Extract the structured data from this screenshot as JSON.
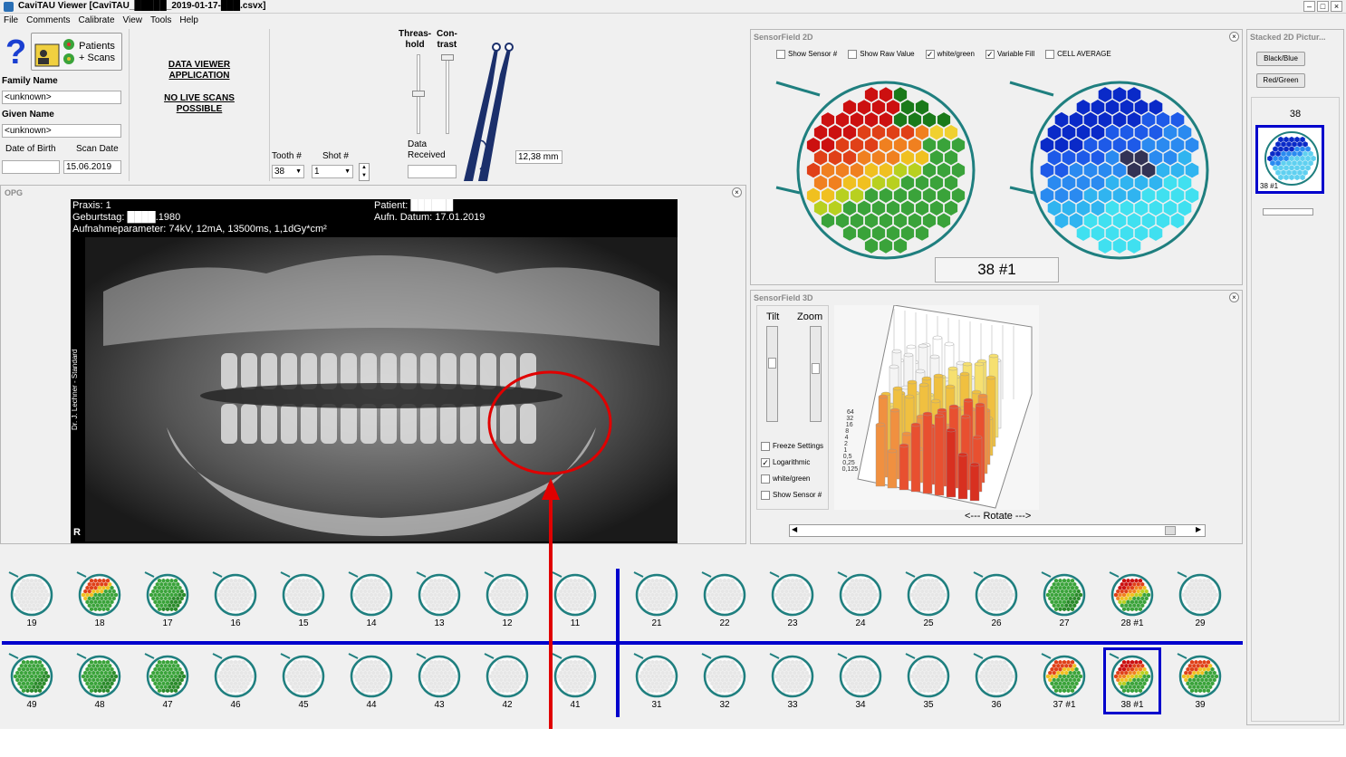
{
  "window": {
    "title": "CaviTAU Viewer [CaviTAU_█████_2019-01-17-███.csvx]"
  },
  "menu": [
    "File",
    "Comments",
    "Calibrate",
    "View",
    "Tools",
    "Help"
  ],
  "patient": {
    "button_label": "Patients\n+ Scans",
    "family_label": "Family Name",
    "family_value": "<unknown>",
    "given_label": "Given Name",
    "given_value": "<unknown>",
    "dob_label": "Date of Birth",
    "dob_value": "",
    "scan_label": "Scan Date",
    "scan_value": "15.06.2019"
  },
  "notice": {
    "line1": "DATA VIEWER",
    "line2": "APPLICATION",
    "line3": "NO LIVE SCANS",
    "line4": "POSSIBLE"
  },
  "selectors": {
    "tooth_label": "Tooth #",
    "tooth_value": "38",
    "shot_label": "Shot #",
    "shot_value": "1"
  },
  "controls": {
    "threshold_label_1": "Threas-",
    "threshold_label_2": "hold",
    "contrast_label_1": "Con-",
    "contrast_label_2": "trast",
    "data_received_1": "Data",
    "data_received_2": "Received",
    "measure": "12,38 mm"
  },
  "sensorfield2d": {
    "title": "SensorField 2D",
    "options": [
      {
        "label": "Show Sensor #",
        "checked": false
      },
      {
        "label": "Show Raw Value",
        "checked": false
      },
      {
        "label": "white/green",
        "checked": true
      },
      {
        "label": "Variable Fill",
        "checked": true
      },
      {
        "label": "CELL AVERAGE",
        "checked": false
      }
    ],
    "readout": "38 #1"
  },
  "stacked": {
    "title": "Stacked 2D Pictur...",
    "btn_blue": "Black/Blue",
    "btn_red": "Red/Green",
    "tooth": "38",
    "thumb_label": "38 #1"
  },
  "opg": {
    "title": "OPG",
    "praxis": "Praxis: 1",
    "patient": "Patient: ██████",
    "birth": "Geburtstag: ████.1980",
    "date": "Aufn. Datum: 17.01.2019",
    "params": "Aufnahmeparameter: 74kV, 12mA, 13500ms, 1,1dGy*cm²",
    "side": "Dr. J. Lechner - Standard",
    "marker": "R"
  },
  "sensorfield3d": {
    "title": "SensorField 3D",
    "tilt": "Tilt",
    "zoom": "Zoom",
    "options": [
      {
        "label": "Freeze Settings",
        "checked": false
      },
      {
        "label": "Logarithmic",
        "checked": true
      },
      {
        "label": "white/green",
        "checked": false
      },
      {
        "label": "Show Sensor #",
        "checked": false
      }
    ],
    "axis_ticks": [
      "64",
      "32",
      "16",
      "8",
      "4",
      "2",
      "1",
      "0,5",
      "0,25",
      "0,125"
    ],
    "rotate": "<--- Rotate --->"
  },
  "upper_teeth": [
    {
      "label": "19",
      "fill": "empty"
    },
    {
      "label": "18",
      "fill": "mixed"
    },
    {
      "label": "17",
      "fill": "green"
    },
    {
      "label": "16",
      "fill": "empty"
    },
    {
      "label": "15",
      "fill": "empty"
    },
    {
      "label": "14",
      "fill": "empty"
    },
    {
      "label": "13",
      "fill": "empty"
    },
    {
      "label": "12",
      "fill": "empty"
    },
    {
      "label": "11",
      "fill": "empty"
    },
    {
      "label": "21",
      "fill": "empty"
    },
    {
      "label": "22",
      "fill": "empty"
    },
    {
      "label": "23",
      "fill": "empty"
    },
    {
      "label": "24",
      "fill": "empty"
    },
    {
      "label": "25",
      "fill": "empty"
    },
    {
      "label": "26",
      "fill": "empty"
    },
    {
      "label": "27",
      "fill": "green"
    },
    {
      "label": "28 #1",
      "fill": "red"
    },
    {
      "label": "29",
      "fill": "empty"
    }
  ],
  "lower_teeth": [
    {
      "label": "49",
      "fill": "green"
    },
    {
      "label": "48",
      "fill": "green"
    },
    {
      "label": "47",
      "fill": "green"
    },
    {
      "label": "46",
      "fill": "empty"
    },
    {
      "label": "45",
      "fill": "empty"
    },
    {
      "label": "44",
      "fill": "empty"
    },
    {
      "label": "43",
      "fill": "empty"
    },
    {
      "label": "42",
      "fill": "empty"
    },
    {
      "label": "41",
      "fill": "empty"
    },
    {
      "label": "31",
      "fill": "empty"
    },
    {
      "label": "32",
      "fill": "empty"
    },
    {
      "label": "33",
      "fill": "empty"
    },
    {
      "label": "34",
      "fill": "empty"
    },
    {
      "label": "35",
      "fill": "empty"
    },
    {
      "label": "36",
      "fill": "empty"
    },
    {
      "label": "37 #1",
      "fill": "mixed"
    },
    {
      "label": "38 #1",
      "fill": "red",
      "selected": true
    },
    {
      "label": "39",
      "fill": "mixed"
    }
  ],
  "colors": {
    "teal": "#1f7f7f",
    "selection": "#0000cc",
    "annotation": "#e00000"
  }
}
